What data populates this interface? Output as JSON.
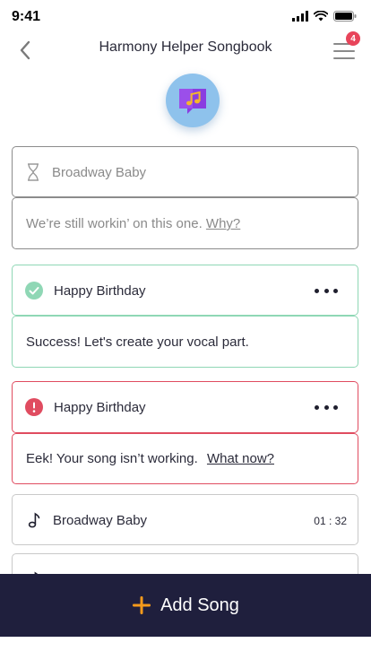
{
  "status_bar": {
    "time": "9:41"
  },
  "nav": {
    "title": "Harmony Helper Songbook",
    "menu_badge": "4"
  },
  "cards": {
    "pending": {
      "title": "Broadway Baby",
      "message": "We’re still workin’ on this one.",
      "link": "Why?"
    },
    "success": {
      "title": "Happy Birthday",
      "message": "Success! Let's create your vocal part."
    },
    "error": {
      "title": "Happy Birthday",
      "message": "Eek! Your song isn’t working.",
      "link": "What now?"
    },
    "song": {
      "title": "Broadway Baby",
      "duration": "01 : 32"
    }
  },
  "bottom": {
    "add_label": "Add Song"
  },
  "colors": {
    "success": "#8fd7b5",
    "error": "#e04c60",
    "accent": "#f59a1b",
    "bottom_bar": "#1f1f3d",
    "logo_circle": "#8ec2ec",
    "logo_book": "#8a3de0"
  }
}
